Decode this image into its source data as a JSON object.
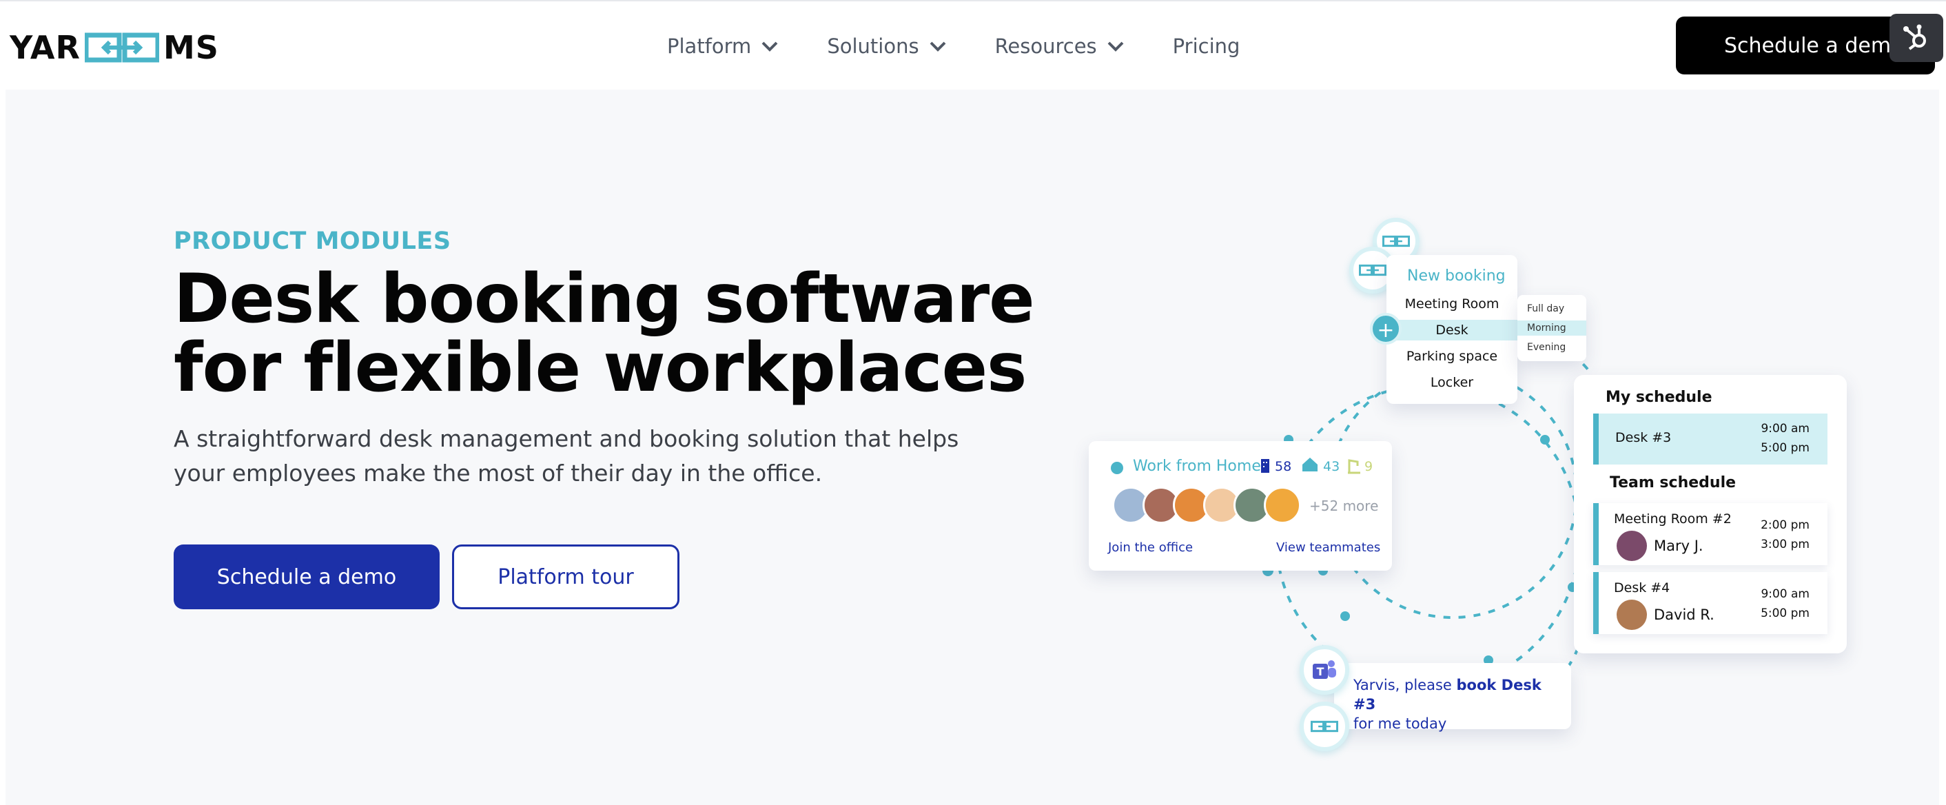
{
  "header": {
    "logo_left": "YAR",
    "logo_right": "MS",
    "nav": [
      {
        "label": "Platform",
        "has_dropdown": true
      },
      {
        "label": "Solutions",
        "has_dropdown": true
      },
      {
        "label": "Resources",
        "has_dropdown": true
      },
      {
        "label": "Pricing",
        "has_dropdown": false
      }
    ],
    "cta_label": "Schedule a demo",
    "hubspot_icon": "hubspot-icon"
  },
  "hero": {
    "eyebrow": "PRODUCT MODULES",
    "headline_line1": "Desk booking software",
    "headline_line2": "for flexible workplaces",
    "subtext": "A straightforward desk management and booking solution that helps your employees make the most of their day in the office.",
    "primary_button": "Schedule a demo",
    "secondary_button": "Platform tour"
  },
  "illustration": {
    "booking": {
      "title": "New booking",
      "items": [
        "Meeting Room",
        "Desk",
        "Parking space",
        "Locker"
      ],
      "selected": "Desk",
      "time_options": [
        "Full day",
        "Morning",
        "Evening"
      ],
      "selected_time": "Morning"
    },
    "wfh": {
      "title": "Work from Home",
      "stat_office": "58",
      "stat_home": "43",
      "stat_leave": "9",
      "more": "+52 more",
      "join_link": "Join the office",
      "view_link": "View teammates"
    },
    "schedule": {
      "my_title": "My schedule",
      "my_item": {
        "title": "Desk #3",
        "start": "9:00 am",
        "end": "5:00 pm"
      },
      "team_title": "Team schedule",
      "team_items": [
        {
          "title": "Meeting Room #2",
          "person": "Mary J.",
          "start": "2:00 pm",
          "end": "3:00 pm"
        },
        {
          "title": "Desk #4",
          "person": "David R.",
          "start": "9:00 am",
          "end": "5:00 pm"
        }
      ]
    },
    "chat": {
      "prefix": "Yarvis, please ",
      "bold": "book Desk #3",
      "suffix": "for me today"
    }
  },
  "colors": {
    "brand_blue": "#1c30a8",
    "accent_teal": "#4ab4c8",
    "hero_bg": "#f7f8fa",
    "black": "#000000"
  }
}
